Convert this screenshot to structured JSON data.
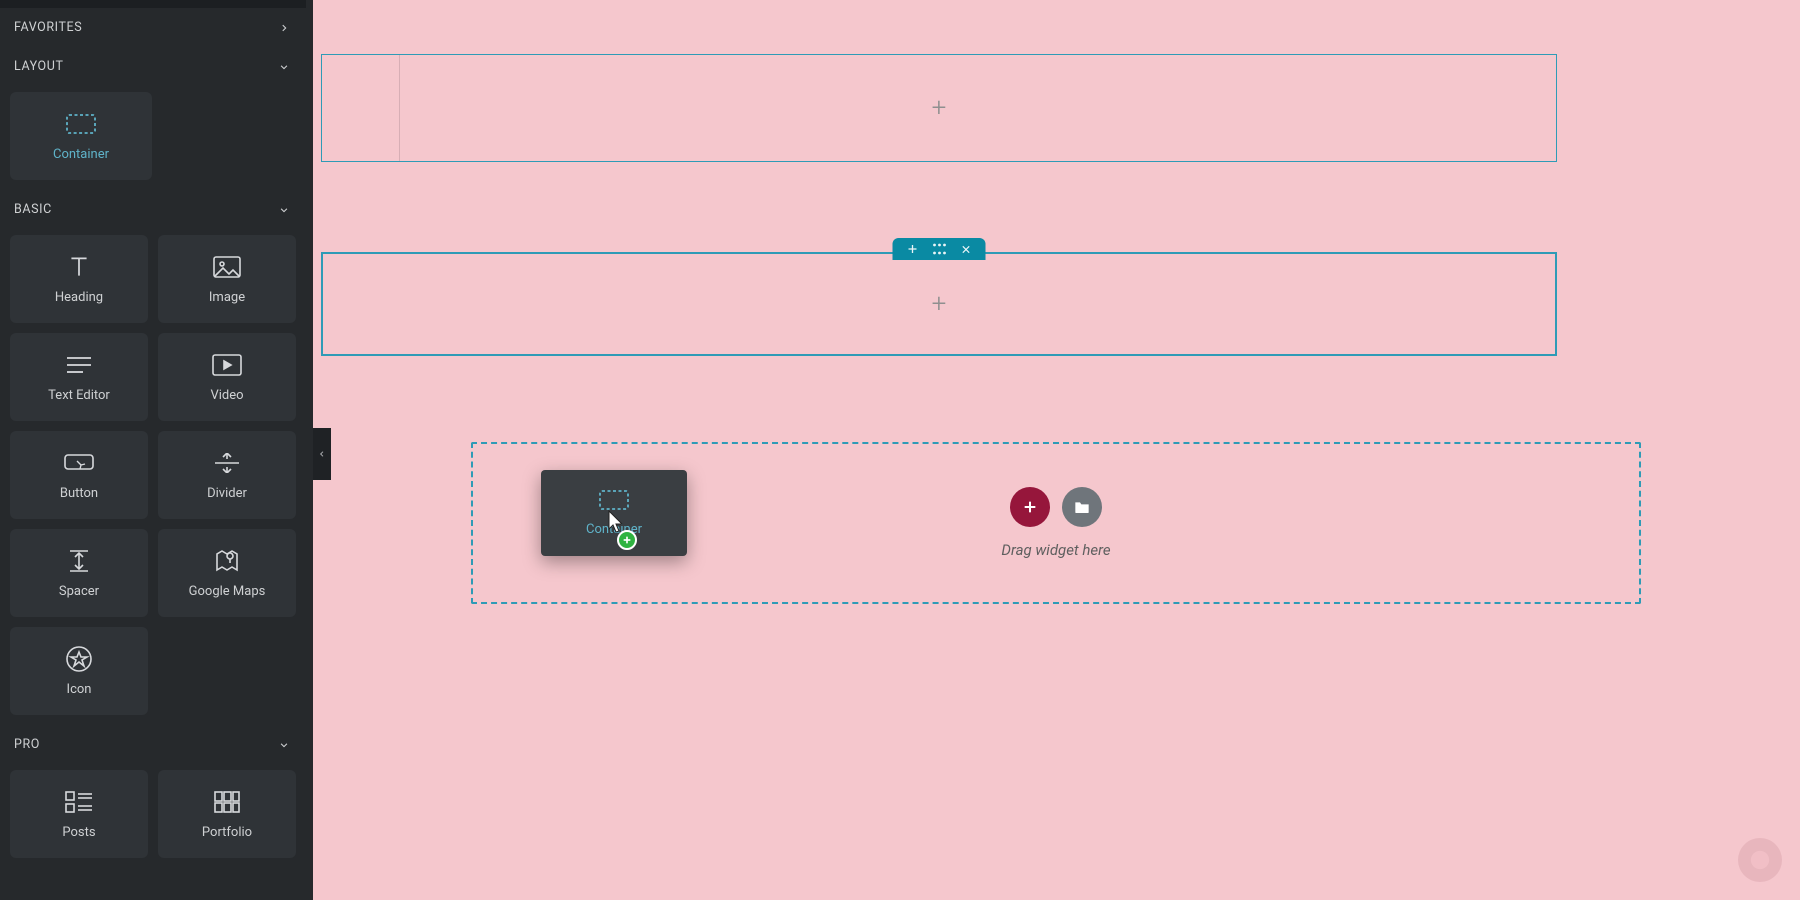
{
  "sidebar": {
    "sections": {
      "favorites": {
        "label": "FAVORITES"
      },
      "layout": {
        "label": "LAYOUT"
      },
      "basic": {
        "label": "BASIC"
      },
      "pro": {
        "label": "PRO"
      }
    },
    "layout_widgets": {
      "container": "Container"
    },
    "basic_widgets": {
      "heading": "Heading",
      "image": "Image",
      "text_editor": "Text Editor",
      "video": "Video",
      "button": "Button",
      "divider": "Divider",
      "spacer": "Spacer",
      "google_maps": "Google Maps",
      "icon": "Icon"
    },
    "pro_widgets": {
      "posts": "Posts",
      "portfolio": "Portfolio"
    }
  },
  "canvas": {
    "drag_hint": "Drag widget here",
    "drag_ghost_label": "Container"
  },
  "colors": {
    "accent": "#0a8aa3",
    "page_bg": "#f5c7cd",
    "add_btn": "#96163b"
  }
}
